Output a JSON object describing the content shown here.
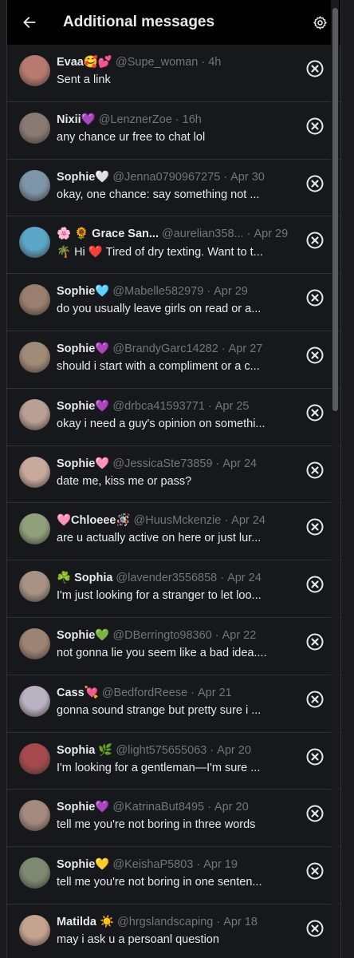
{
  "header": {
    "title": "Additional messages",
    "back_icon": "arrow-left-icon",
    "settings_icon": "gear-icon"
  },
  "messages": [
    {
      "name": "Evaa🥰💕",
      "handle": "@Supe_woman",
      "time": "4h",
      "text": "Sent a link",
      "avatar_color": "#b77a6e"
    },
    {
      "name": "Nixii💜",
      "handle": "@LenznerZoe",
      "time": "16h",
      "text": "any chance ur free to chat lol",
      "avatar_color": "#8a7a72"
    },
    {
      "name": "Sophie🤍",
      "handle": "@Jenna0790967275",
      "time": "Apr 30",
      "text": "okay, one chance: say something not ...",
      "avatar_color": "#7c96a8"
    },
    {
      "name": "🌸 🌻 Grace San...",
      "handle": "@aurelian358...",
      "time": "Apr 29",
      "text": "🌴 Hi ❤️ Tired of dry texting. Want to t...",
      "avatar_color": "#5aa6c8"
    },
    {
      "name": "Sophie🩵",
      "handle": "@Mabelle582979",
      "time": "Apr 29",
      "text": "do you usually leave girls on read or a...",
      "avatar_color": "#9a7f6e"
    },
    {
      "name": "Sophie💜",
      "handle": "@BrandyGarc14282",
      "time": "Apr 27",
      "text": "should i start with a compliment or a c...",
      "avatar_color": "#a08a78"
    },
    {
      "name": "Sophie💜",
      "handle": "@drbca41593771",
      "time": "Apr 25",
      "text": "okay i need a guy's opinion on somethi...",
      "avatar_color": "#b8a093"
    },
    {
      "name": "Sophie🩷",
      "handle": "@JessicaSte73859",
      "time": "Apr 24",
      "text": "date me, kiss me or pass?",
      "avatar_color": "#c9a99c"
    },
    {
      "name": "🩷Chloeee🪅",
      "handle": "@HuusMckenzie",
      "time": "Apr 24",
      "text": "are u actually active on here or just lur...",
      "avatar_color": "#8fa07a"
    },
    {
      "name": "☘️ Sophia",
      "handle": "@lavender3556858",
      "time": "Apr 24",
      "text": "I'm just looking for a stranger to let loo...",
      "avatar_color": "#a79283"
    },
    {
      "name": "Sophie💚",
      "handle": "@DBerringto98360",
      "time": "Apr 22",
      "text": "not gonna lie you seem like a bad idea....",
      "avatar_color": "#9c8474"
    },
    {
      "name": "Cass💘",
      "handle": "@BedfordReese",
      "time": "Apr 21",
      "text": "gonna sound strange but pretty sure i ...",
      "avatar_color": "#b9b3c2"
    },
    {
      "name": "Sophia 🌿",
      "handle": "@light575655063",
      "time": "Apr 20",
      "text": "I'm looking for a gentleman—I'm sure ...",
      "avatar_color": "#a44a4a"
    },
    {
      "name": "Sophie💜",
      "handle": "@KatrinaBut8495",
      "time": "Apr 20",
      "text": "tell me you're not boring in three words",
      "avatar_color": "#a48a7e"
    },
    {
      "name": "Sophie💛",
      "handle": "@KeishaP5803",
      "time": "Apr 19",
      "text": "tell me you're not boring in one senten...",
      "avatar_color": "#7e8a6f"
    },
    {
      "name": "Matilda ☀️",
      "handle": "@hrgslandscaping",
      "time": "Apr 18",
      "text": "may i ask u a persoanl question",
      "avatar_color": "#c4a38f"
    }
  ],
  "row_close_icon": "close-circle-icon",
  "separator": "·"
}
